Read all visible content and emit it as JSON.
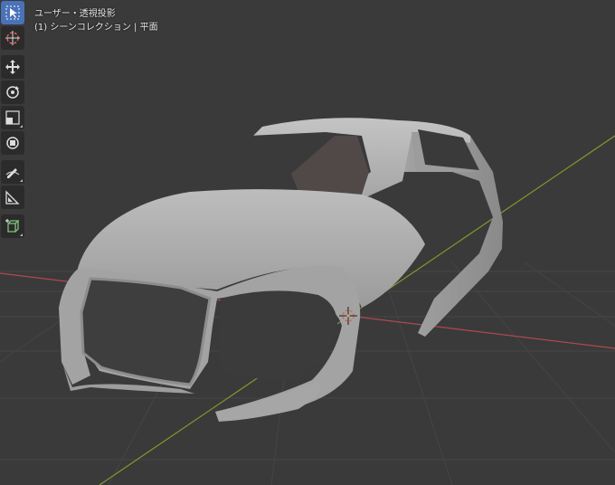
{
  "viewport": {
    "view_name": "ユーザー・透視投影",
    "collection_line": "(1) シーンコレクション | 平面"
  },
  "toolbar": {
    "tools": [
      {
        "name": "select-box",
        "icon": "cursor-arrow-icon",
        "active": true
      },
      {
        "name": "cursor",
        "icon": "3d-cursor-icon",
        "active": false
      },
      {
        "name": "move",
        "icon": "move-arrows-icon",
        "active": false
      },
      {
        "name": "rotate",
        "icon": "rotate-icon",
        "active": false
      },
      {
        "name": "scale",
        "icon": "scale-icon",
        "active": false
      },
      {
        "name": "transform",
        "icon": "transform-icon",
        "active": false
      },
      {
        "name": "annotate",
        "icon": "annotate-pencil-icon",
        "active": false
      },
      {
        "name": "measure",
        "icon": "measure-ruler-icon",
        "active": false
      },
      {
        "name": "add-cube",
        "icon": "add-cube-icon",
        "active": false
      }
    ]
  },
  "colors": {
    "background": "#3a3a3a",
    "grid": "#454545",
    "x_axis": "#b0494f",
    "y_axis": "#7f9a2e",
    "active_tool": "#4a72b8",
    "mesh": "#a9a9a9"
  }
}
